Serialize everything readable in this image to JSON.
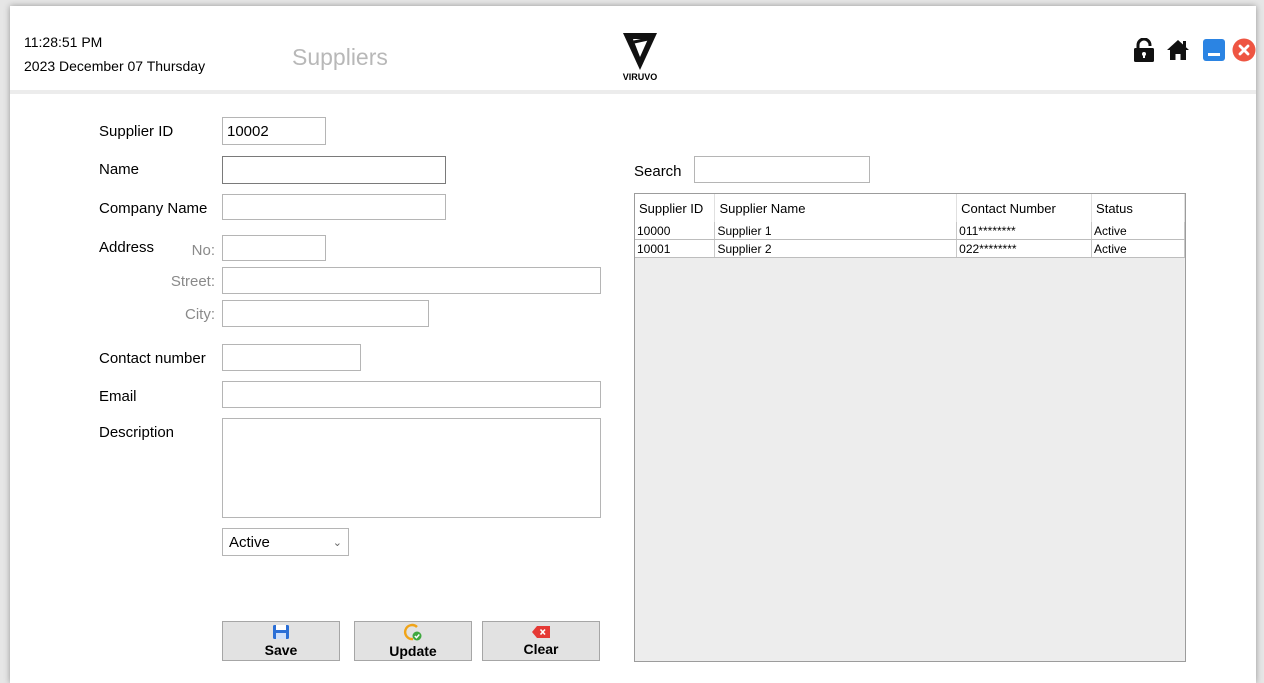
{
  "header": {
    "time": "11:28:51 PM",
    "date": "2023  December  07 Thursday",
    "title": "Suppliers",
    "logo_text": "VIRUVO",
    "icons": [
      "lock-icon",
      "home-icon",
      "minimize-icon",
      "close-icon"
    ],
    "colors": {
      "minimize": "#2b84e3",
      "close": "#ee5542",
      "title": "#b8b8b8"
    }
  },
  "form": {
    "supplier_id_label": "Supplier ID",
    "supplier_id_value": "10002",
    "name_label": "Name",
    "company_label": "Company Name",
    "address_label": "Address",
    "no_label": "No:",
    "street_label": "Street:",
    "city_label": "City:",
    "contact_label": "Contact number",
    "email_label": "Email",
    "description_label": "Description",
    "status_value": "Active"
  },
  "buttons": {
    "save": "Save",
    "update": "Update",
    "clear": "Clear"
  },
  "search": {
    "label": "Search"
  },
  "table": {
    "columns": [
      "Supplier ID",
      "Supplier Name",
      "Contact Number",
      "Status"
    ],
    "rows": [
      [
        "10000",
        "Supplier 1",
        "011********",
        "Active"
      ],
      [
        "10001",
        "Supplier 2",
        "022********",
        "Active"
      ]
    ]
  }
}
